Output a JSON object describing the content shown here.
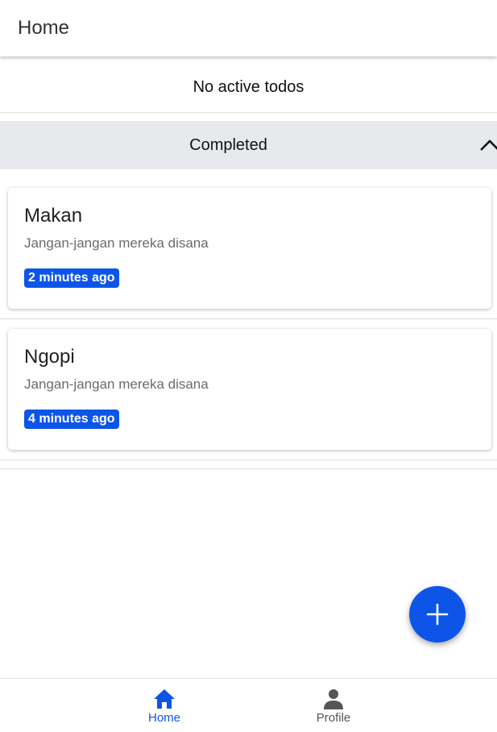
{
  "app_bar": {
    "title": "Home"
  },
  "active": {
    "empty_text": "No active todos"
  },
  "completed_section": {
    "title": "Completed",
    "expanded_icon": "chevron-up-icon",
    "items": [
      {
        "title": "Makan",
        "description": "Jangan-jangan mereka disana",
        "time": "2 minutes ago"
      },
      {
        "title": "Ngopi",
        "description": "Jangan-jangan mereka disana",
        "time": "4 minutes ago"
      }
    ]
  },
  "fab": {
    "icon": "plus-icon"
  },
  "bottom_nav": {
    "items": [
      {
        "label": "Home",
        "icon": "home-icon",
        "active": true
      },
      {
        "label": "Profile",
        "icon": "person-icon",
        "active": false
      }
    ]
  },
  "colors": {
    "accent": "#0d55e8",
    "section_bg": "#e8e9ec"
  }
}
